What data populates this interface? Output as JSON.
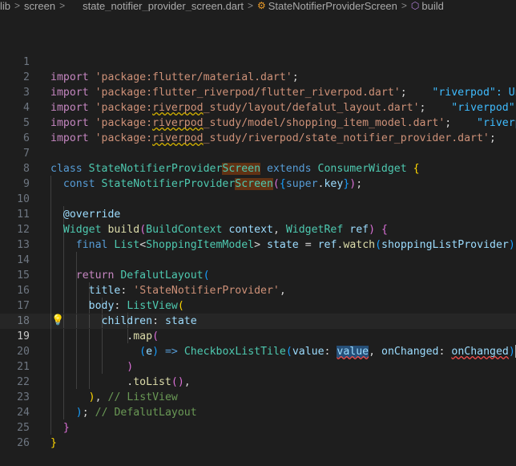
{
  "breadcrumb": {
    "items": [
      "lib",
      "screen",
      "state_notifier_provider_screen.dart",
      "StateNotifierProviderScreen",
      "build"
    ],
    "separator": ">"
  },
  "editor": {
    "active_line": 19,
    "lines": [
      {
        "n": "1"
      },
      {
        "n": "2"
      },
      {
        "n": "3"
      },
      {
        "n": "4"
      },
      {
        "n": "5"
      },
      {
        "n": "6"
      },
      {
        "n": "7"
      },
      {
        "n": "8"
      },
      {
        "n": "9"
      },
      {
        "n": "10"
      },
      {
        "n": "11"
      },
      {
        "n": "12"
      },
      {
        "n": "13"
      },
      {
        "n": "14"
      },
      {
        "n": "15"
      },
      {
        "n": "16"
      },
      {
        "n": "17"
      },
      {
        "n": "18"
      },
      {
        "n": "19"
      },
      {
        "n": "20"
      },
      {
        "n": "21"
      },
      {
        "n": "22"
      },
      {
        "n": "23"
      },
      {
        "n": "24"
      },
      {
        "n": "25"
      },
      {
        "n": "26"
      }
    ],
    "code": {
      "l1": {
        "kw": "import",
        "str": "'package:flutter/material.dart'",
        "end": ";"
      },
      "l2": {
        "kw": "import",
        "str": "'package:flutter_riverpod/flutter_riverpod.dart'",
        "end": ";",
        "hint": "\"riverpod\": Unkn"
      },
      "l3": {
        "kw": "import",
        "str_a": "'package:",
        "str_b": "riverpod",
        "str_c": "_study/layout/defalut_layout.dart'",
        "end": ";",
        "hint": "\"riverpod\": U"
      },
      "l4": {
        "kw": "import",
        "str_a": "'package:",
        "str_b": "riverpod",
        "str_c": "_study/model/shopping_item_model.dart'",
        "end": ";",
        "hint": "\"riverpod"
      },
      "l5": {
        "kw": "import",
        "str_a": "'package:",
        "str_b": "riverpod",
        "str_c": "_study/riverpod/state_notifier_provider.dart'",
        "end": ";",
        "hint": "\"r"
      },
      "l7": {
        "kw": "class",
        "name_a": "StateNotifierProvider",
        "name_b": "Screen",
        "ext": "extends",
        "super": "ConsumerWidget",
        "brace": "{"
      },
      "l8": {
        "kw": "const",
        "name_a": "StateNotifierProvider",
        "name_b": "Screen",
        "p1": "(",
        "p2": "{",
        "sup": "super",
        "dot": ".",
        "key": "key",
        "p3": "}",
        "p4": ")",
        "end": ";"
      },
      "l10": {
        "ann": "@override"
      },
      "l11": {
        "type": "Widget",
        "fn": "build",
        "p1": "(",
        "t1": "BuildContext",
        "a1": "context",
        "comma": ",",
        "t2": "WidgetRef",
        "a2": "ref",
        "p2": ")",
        "brace": "{"
      },
      "l12": {
        "kw": "final",
        "type": "List",
        "lt": "<",
        "gen": "ShoppingItemModel",
        "gt": ">",
        "var": "state",
        "eq": "=",
        "obj": "ref",
        "dot": ".",
        "fn": "watch",
        "p1": "(",
        "arg": "shoppingListProvider",
        "p2": ")",
        "end": ";"
      },
      "l14": {
        "kw": "return",
        "cls": "DefalutLayout",
        "p": "("
      },
      "l15": {
        "prop": "title",
        "colon": ":",
        "str": "'StateNotifierProvider'",
        "comma": ","
      },
      "l16": {
        "prop": "body",
        "colon": ":",
        "cls": "ListView",
        "p": "("
      },
      "l17": {
        "prop": "children",
        "colon": ":",
        "var": "state"
      },
      "l18": {
        "dot": ".",
        "fn": "map",
        "p": "("
      },
      "l19": {
        "p1": "(",
        "arg": "e",
        "p2": ")",
        "arrow": "=>",
        "cls": "CheckboxListTile",
        "p3": "(",
        "k1": "value",
        "c1": ":",
        "v1": "value",
        "comma1": ",",
        "k2": "onChanged",
        "c2": ":",
        "v2": "onChanged",
        "p4": ")",
        "comma2": ","
      },
      "l20": {
        "p": ")"
      },
      "l21": {
        "dot": ".",
        "fn": "toList",
        "p": "()",
        "comma": ","
      },
      "l22": {
        "p": ")",
        "comma": ",",
        "cm": "// ListView"
      },
      "l23": {
        "p": ")",
        "end": ";",
        "cm": "// DefalutLayout"
      },
      "l24": {
        "brace": "}"
      },
      "l25": {
        "brace": "}"
      }
    }
  },
  "icons": {
    "class": "class-symbol-icon",
    "method": "method-symbol-icon",
    "lightbulb": "lightbulb-icon"
  },
  "colors": {
    "background": "#1e1e1e",
    "keyword": "#569cd6",
    "control_keyword": "#c586c0",
    "string": "#ce9178",
    "type": "#4ec9b0",
    "function": "#dcdcaa",
    "variable": "#9cdcfe",
    "comment": "#6a9955",
    "error_squiggle": "#f14c4c",
    "warning_squiggle": "#d1b000"
  }
}
